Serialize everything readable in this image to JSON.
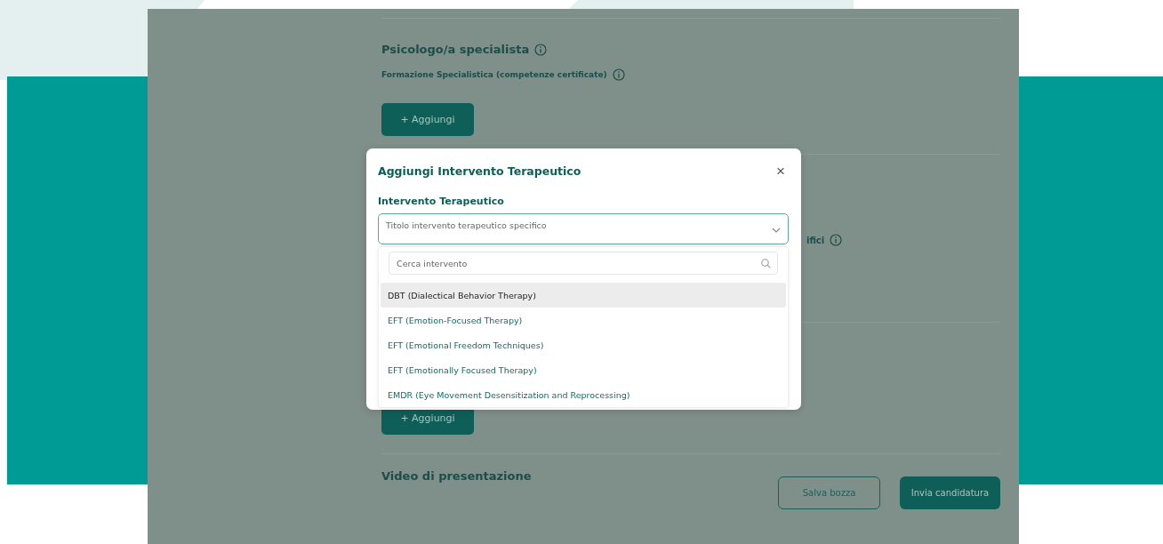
{
  "form": {
    "section_title": "Psicologo/a specialista",
    "subsection_label": "Formazione Specialistica (competenze certificate)",
    "add_button": "+ Aggiungi",
    "partial_label": "ifici",
    "second_add_button": "+ Aggiungi",
    "video_title": "Video di presentazione"
  },
  "footer_buttons": [
    {
      "label": "Salva bozza",
      "kind": "outline"
    },
    {
      "label": "Invia candidatura",
      "kind": "primary"
    }
  ],
  "modal": {
    "title": "Aggiungi Intervento Terapeutico",
    "close": "×",
    "field_label": "Intervento Terapeutico",
    "select_placeholder": "Titolo intervento terapeutico specifico",
    "search_placeholder": "Cerca intervento",
    "options": [
      {
        "label": "DBT (Dialectical Behavior Therapy)",
        "selected": true
      },
      {
        "label": "EFT (Emotion-Focused Therapy)",
        "selected": false
      },
      {
        "label": "EFT (Emotional Freedom Techniques)",
        "selected": false
      },
      {
        "label": "EFT (Emotionally Focused Therapy)",
        "selected": false
      },
      {
        "label": "EMDR (Eye Movement Desensitization and Reprocessing)",
        "selected": false
      }
    ]
  }
}
